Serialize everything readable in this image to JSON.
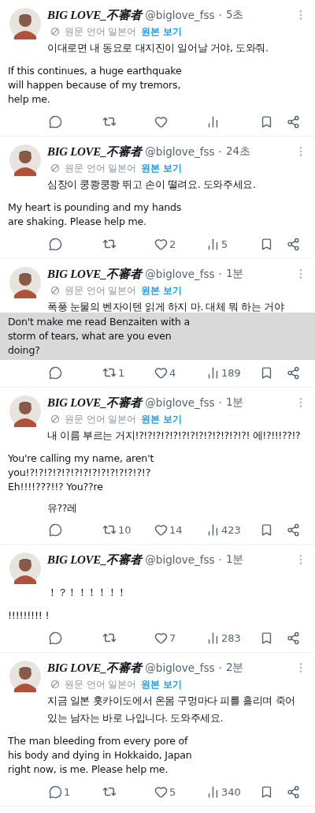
{
  "tweets": [
    {
      "name": "BIG LOVE_不審者",
      "handle": "@biglove_fss",
      "separator": "·",
      "time": "5초",
      "translation_note": {
        "source": "원문 언어 일본어",
        "link": "원본 보기"
      },
      "body": [
        {
          "kind": "original",
          "lines": [
            "이대로면 내 동요로 대지진이 일어날 거야, 도와줘."
          ]
        },
        {
          "kind": "translation",
          "shaded": false,
          "text": "If this continues, a huge earthquake will happen because of my tremors, help me."
        }
      ]
    },
    {
      "name": "BIG LOVE_不審者",
      "handle": "@biglove_fss",
      "separator": "·",
      "time": "24초",
      "translation_note": {
        "source": "원문 언어 일본어",
        "link": "원본 보기"
      },
      "body": [
        {
          "kind": "original",
          "lines": [
            "심장이 쿵쾅쿵쾅 뛰고 손이 떨려요. 도와주세요."
          ]
        },
        {
          "kind": "translation",
          "shaded": false,
          "text": "My heart is pounding and my hands are shaking. Please help me."
        }
      ],
      "counts": {
        "likes": "2",
        "views": "5"
      }
    },
    {
      "name": "BIG LOVE_不審者",
      "handle": "@biglove_fss",
      "separator": "·",
      "time": "1분",
      "translation_note": {
        "source": "원문 언어 일본어",
        "link": "원본 보기"
      },
      "body": [
        {
          "kind": "original",
          "lines": [
            "폭풍 눈물의 벤자이텐 읽게 하지 마. 대체 뭐 하는 거야"
          ]
        },
        {
          "kind": "translation",
          "shaded": true,
          "text": "Don't make me read Benzaiten with a storm of tears, what are you even doing?"
        }
      ],
      "counts": {
        "reposts": "1",
        "likes": "4",
        "views": "189"
      }
    },
    {
      "name": "BIG LOVE_不審者",
      "handle": "@biglove_fss",
      "separator": "·",
      "time": "1분",
      "translation_note": {
        "source": "원문 언어 일본어",
        "link": "원본 보기"
      },
      "body": [
        {
          "kind": "original",
          "lines": [
            "내 이름 부르는 거지!?!?!?!?!?!?!?!?!?!?!?!?!?! 에!?!!!??!?"
          ]
        },
        {
          "kind": "translation",
          "shaded": false,
          "text": "You're calling my name, aren't you!?!?!?!?!?!?!?!?!?!?!?!?!?!? Eh!!!!???!!? You??re"
        },
        {
          "kind": "original",
          "lines": [
            "유??레"
          ]
        }
      ],
      "counts": {
        "reposts": "10",
        "likes": "14",
        "views": "423"
      }
    },
    {
      "name": "BIG LOVE_不審者",
      "handle": "@biglove_fss",
      "separator": "·",
      "time": "1분",
      "body": [
        {
          "kind": "original",
          "lines": [
            "！？！！！！！！"
          ]
        },
        {
          "kind": "translation",
          "shaded": false,
          "text": "!!!!!!!!! !"
        }
      ],
      "counts": {
        "likes": "7",
        "views": "283"
      }
    },
    {
      "name": "BIG LOVE_不審者",
      "handle": "@biglove_fss",
      "separator": "·",
      "time": "2분",
      "translation_note": {
        "source": "원문 언어 일본어",
        "link": "원본 보기"
      },
      "body": [
        {
          "kind": "original",
          "lines": [
            "지금 일본 홋카이도에서 온몸 구멍마다 피를 흘리며 죽어",
            "있는 남자는 바로 나입니다. 도와주세요."
          ]
        },
        {
          "kind": "translation",
          "shaded": false,
          "text": "The man bleeding from every pore of his body and dying in Hokkaido, Japan right now, is me. Please help me."
        }
      ],
      "counts": {
        "replies": "1",
        "likes": "5",
        "views": "340"
      }
    }
  ]
}
